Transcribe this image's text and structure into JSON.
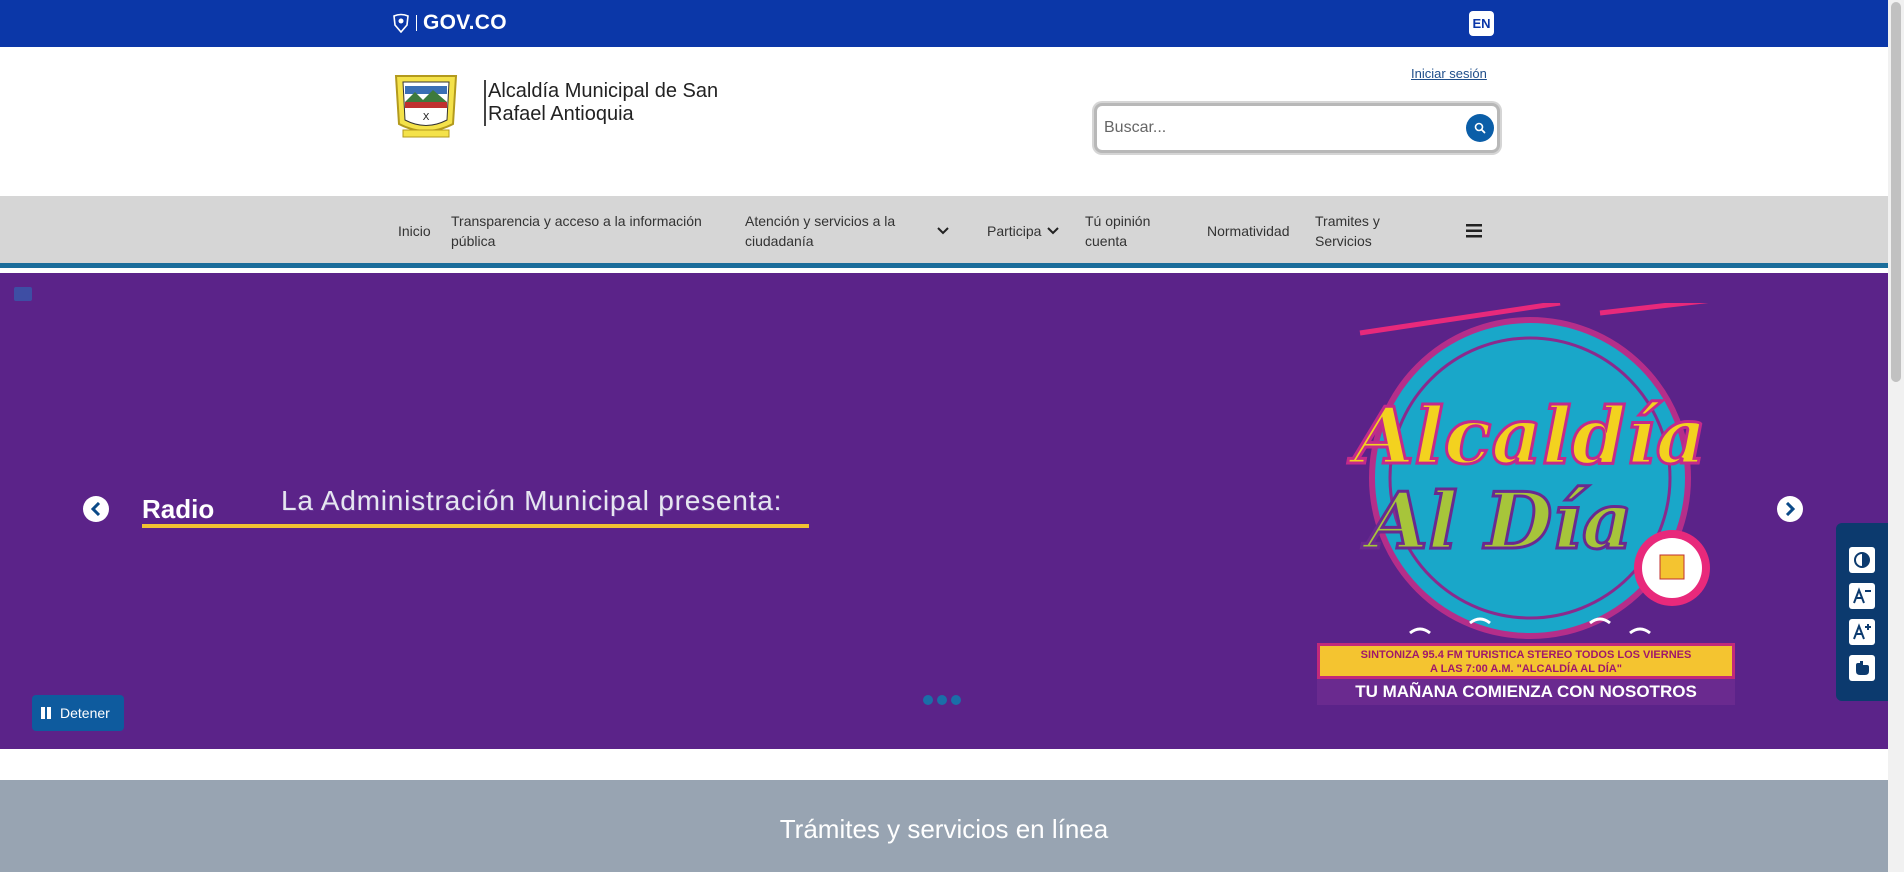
{
  "govbar": {
    "logo_text": "GOV.CO",
    "lang_button": "EN"
  },
  "header": {
    "site_title": "Alcaldía Municipal de San Rafael Antioquia",
    "login_link": "Iniciar sesión",
    "search_placeholder": "Buscar..."
  },
  "nav": {
    "items": [
      {
        "label": "Inicio"
      },
      {
        "label": "Transparencia y acceso a la información pública"
      },
      {
        "label": "Atención y servicios a la ciudadanía"
      },
      {
        "label": "Participa"
      },
      {
        "label": "Tú opinión cuenta"
      },
      {
        "label": "Normatividad"
      },
      {
        "label": "Tramites y Servicios"
      }
    ]
  },
  "hero": {
    "title": "Radio",
    "subtitle": "La Administración Municipal presenta:",
    "stop_button": "Detener",
    "slide_count": 3,
    "promo_title": "Alcaldía Al Día",
    "promo_line1": "SINTONIZA 95.4 FM TURISTICA STEREO TODOS LOS VIERNES",
    "promo_line2": "A LAS 7:00 A.M. \"ALCALDÍA AL DÍA\"",
    "promo_line3": "TU MAÑANA COMIENZA CON NOSOTROS"
  },
  "services": {
    "title": "Trámites y servicios en línea"
  },
  "colors": {
    "govbar": "#0b37a8",
    "hero_bg": "#5b2389",
    "accent": "#0e5b9e",
    "underline": "#f1c232"
  }
}
